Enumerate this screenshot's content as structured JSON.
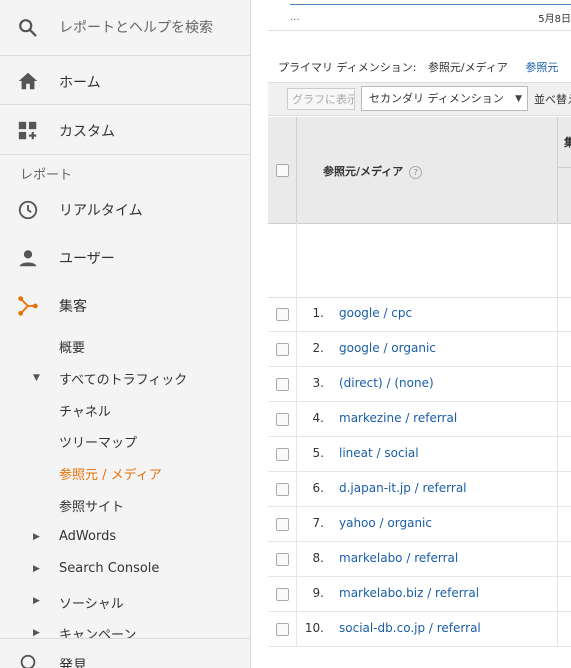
{
  "sidebar": {
    "search_placeholder": "レポートとヘルプを検索",
    "home": "ホーム",
    "custom": "カスタム",
    "section": "レポート",
    "items": [
      {
        "label": "リアルタイム",
        "icon": "clock-icon"
      },
      {
        "label": "ユーザー",
        "icon": "person-icon"
      },
      {
        "label": "集客",
        "icon": "acquisition-icon"
      }
    ],
    "sub": {
      "overview": "概要",
      "all_traffic": "すべてのトラフィック",
      "channels": "チャネル",
      "treemap": "ツリーマップ",
      "source_medium": "参照元 / メディア",
      "referrals": "参照サイト",
      "adwords": "AdWords",
      "search_console": "Search Console",
      "social": "ソーシャル",
      "campaigns": "キャンペーン"
    },
    "bottom": "発見",
    "accent_color": "#e8710a"
  },
  "chart": {
    "dots": "...",
    "date": "5月8日"
  },
  "primary_dimension": {
    "label": "プライマリ ディメンション:",
    "value": "参照元/メディア",
    "alt_link": "参照元"
  },
  "toolbar": {
    "graph_button": "グラフに表示",
    "secondary_dimension": "セカンダリ ディメンション",
    "sort_label": "並べ替え"
  },
  "table": {
    "dim_header": "参照元/メディア",
    "metric_header": "集",
    "rows": [
      {
        "num": "1.",
        "label": "google / cpc"
      },
      {
        "num": "2.",
        "label": "google / organic"
      },
      {
        "num": "3.",
        "label": "(direct) / (none)"
      },
      {
        "num": "4.",
        "label": "markezine / referral"
      },
      {
        "num": "5.",
        "label": "lineat / social"
      },
      {
        "num": "6.",
        "label": "d.japan-it.jp / referral"
      },
      {
        "num": "7.",
        "label": "yahoo / organic"
      },
      {
        "num": "8.",
        "label": "markelabo / referral"
      },
      {
        "num": "9.",
        "label": "markelabo.biz / referral"
      },
      {
        "num": "10.",
        "label": "social-db.co.jp / referral"
      }
    ]
  }
}
